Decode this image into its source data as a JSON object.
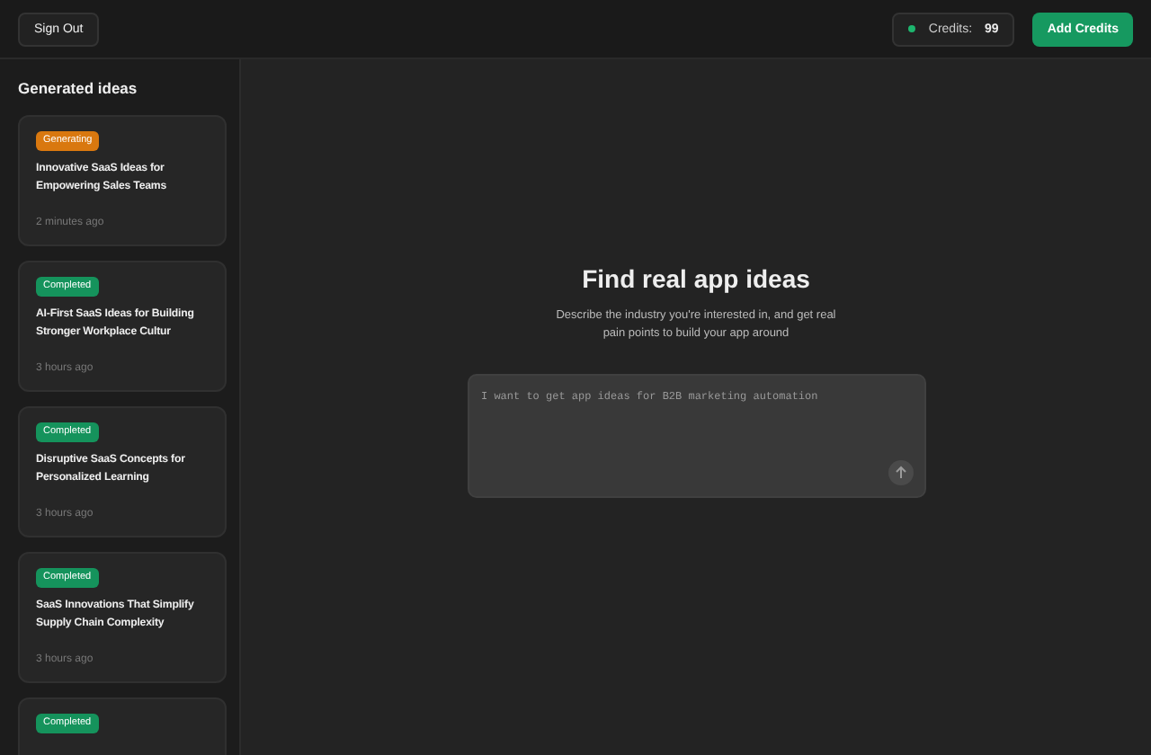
{
  "header": {
    "sign_out": "Sign Out",
    "credits_label": "Credits:",
    "credits_value": "99",
    "add_credits": "Add Credits"
  },
  "sidebar": {
    "title": "Generated ideas",
    "items": [
      {
        "kind": "generating",
        "badge": "Generating",
        "title": "Innovative SaaS Ideas for Empowering Sales Teams",
        "time": "2 minutes ago"
      },
      {
        "kind": "completed",
        "badge": "Completed",
        "title": "AI-First SaaS Ideas for Building Stronger Workplace Cultur",
        "time": "3 hours ago"
      },
      {
        "kind": "completed",
        "badge": "Completed",
        "title": "Disruptive SaaS Concepts for Personalized Learning",
        "time": "3 hours ago"
      },
      {
        "kind": "completed",
        "badge": "Completed",
        "title": "SaaS Innovations That Simplify Supply Chain Complexity",
        "time": "3 hours ago"
      },
      {
        "kind": "completed",
        "badge": "Completed"
      }
    ]
  },
  "main": {
    "heading": "Find real app ideas",
    "subtitle": "Describe the industry you're interested in, and get real pain points to build your app around",
    "prompt": {
      "placeholder": "I want to get app ideas for B2B marketing automation"
    }
  }
}
